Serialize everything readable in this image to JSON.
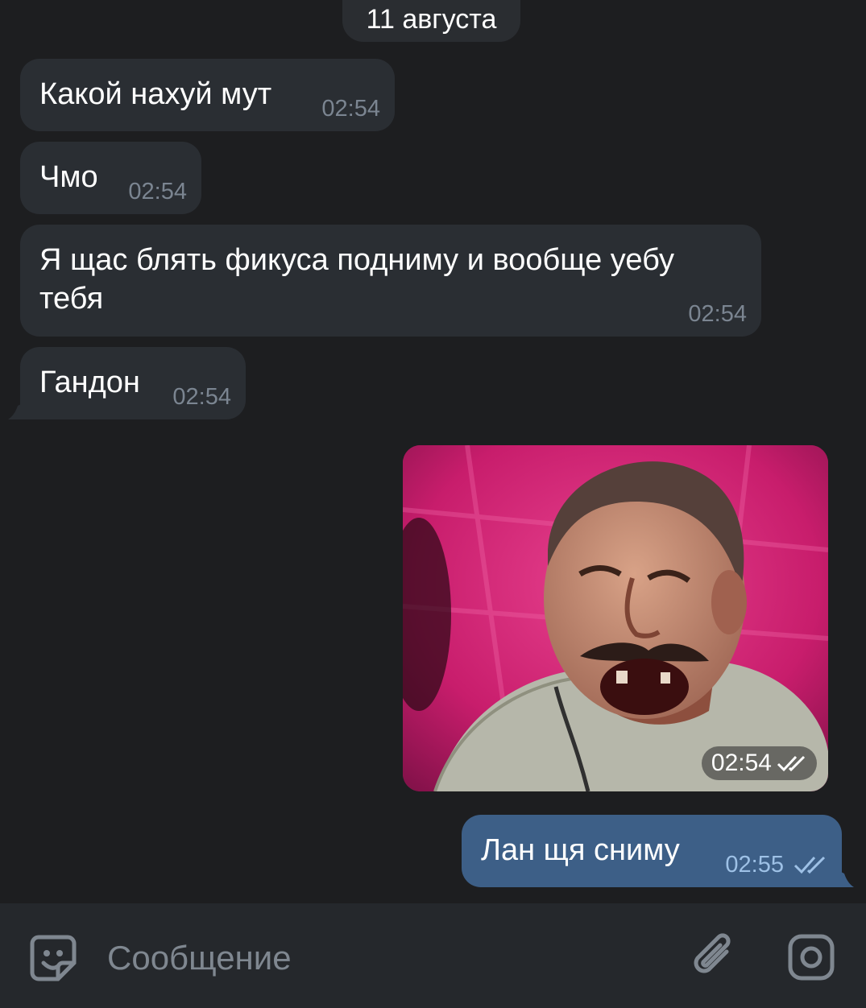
{
  "date_separator": "11 августа",
  "messages": [
    {
      "text": "Какой нахуй мут",
      "time": "02:54"
    },
    {
      "text": "Чмо",
      "time": "02:54"
    },
    {
      "text_line1": "Я щас блять фикуса подниму и вообще уебу",
      "text_line2": "тебя",
      "time": "02:54"
    },
    {
      "text": "Гандон",
      "time": "02:54"
    }
  ],
  "sticker": {
    "icon": "laughing-man-meme",
    "time": "02:54",
    "status": "read"
  },
  "outgoing": {
    "text": "Лан щя сниму",
    "time": "02:55",
    "status": "read"
  },
  "composer": {
    "placeholder": "Сообщение",
    "left_icon": "sticker-icon",
    "attach_icon": "paperclip-icon",
    "camera_icon": "camera-icon"
  },
  "colors": {
    "background": "#1d1e20",
    "incoming_bubble": "#2a2e33",
    "outgoing_bubble": "#3d5f87",
    "check_color": "#9ec1e6"
  }
}
